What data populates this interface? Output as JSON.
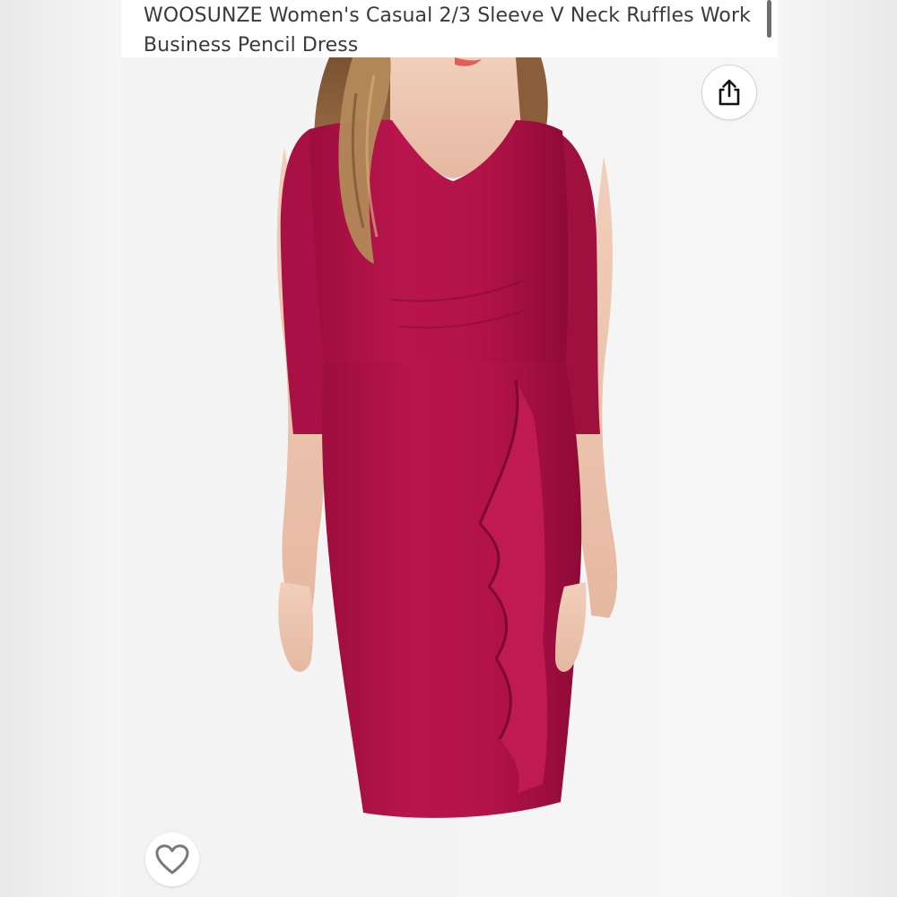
{
  "product": {
    "title": "WOOSUNZE Women's Casual 2/3 Sleeve V Neck Ruffles Work Business Pencil Dress"
  },
  "photo": {
    "dress_color": "#b5134a"
  },
  "actions": {
    "share_icon": "share-icon",
    "wishlist_icon": "heart-outline-icon"
  }
}
